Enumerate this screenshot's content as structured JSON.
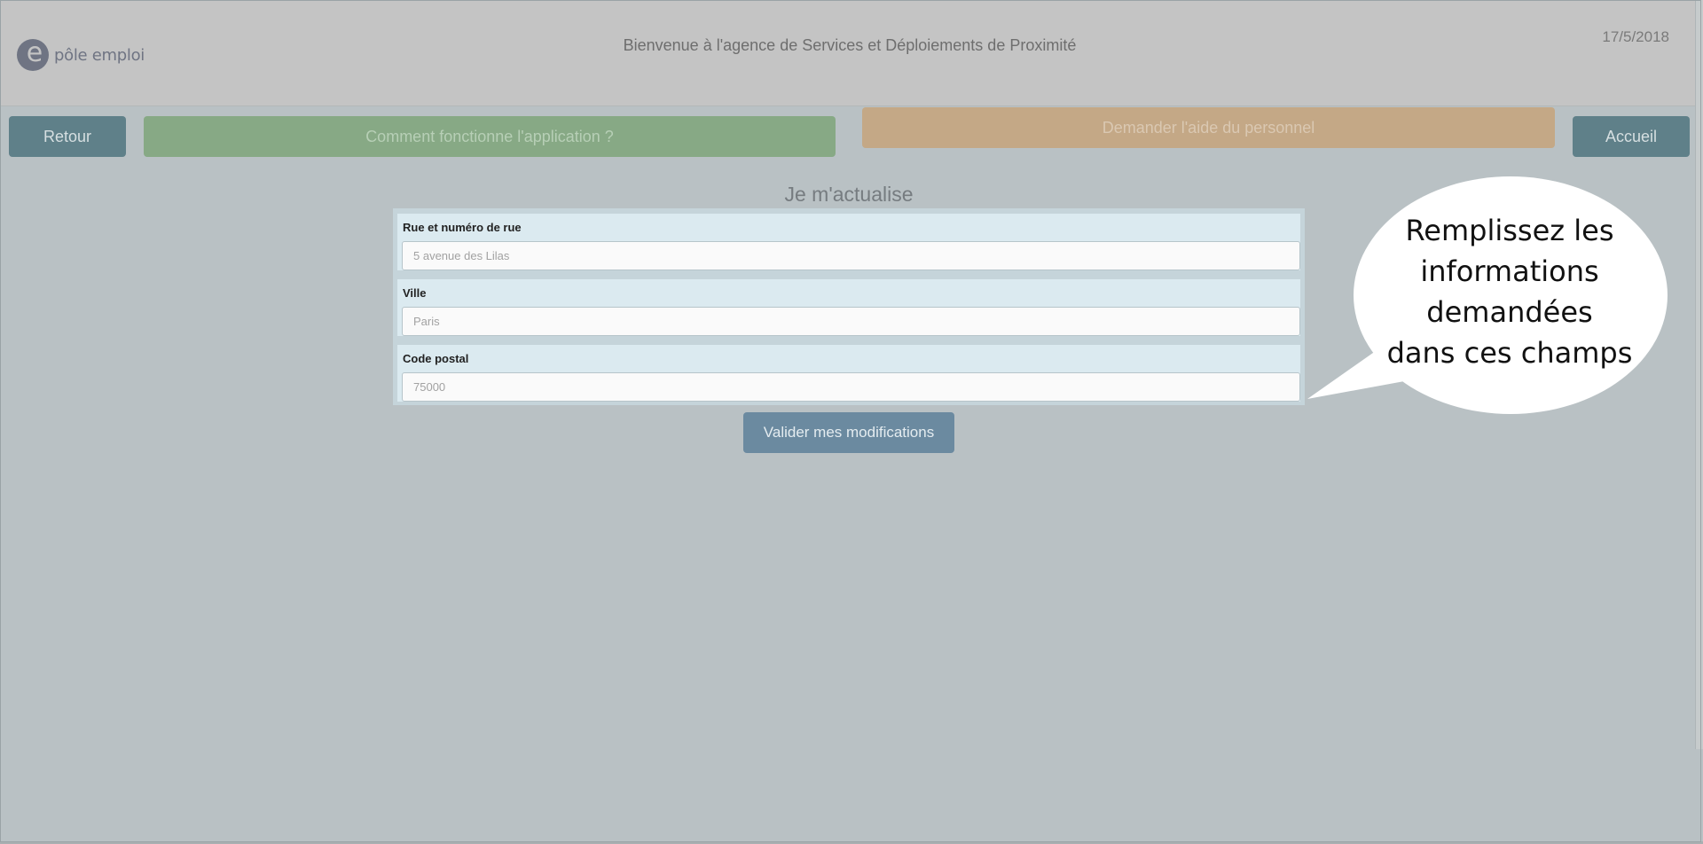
{
  "header": {
    "logo_text": "pôle emploi",
    "welcome": "Bienvenue à l'agence de Services et Déploiements de Proximité",
    "date": "17/5/2018"
  },
  "nav": {
    "retour": "Retour",
    "how_it_works": "Comment fonctionne l'application ?",
    "ask_help": "Demander l'aide du personnel",
    "accueil": "Accueil"
  },
  "form": {
    "title": "Je m'actualise",
    "fields": [
      {
        "label": "Rue et numéro de rue",
        "placeholder": "5 avenue des Lilas"
      },
      {
        "label": "Ville",
        "placeholder": "Paris"
      },
      {
        "label": "Code postal",
        "placeholder": "75000"
      }
    ],
    "submit": "Valider mes modifications"
  },
  "tooltip": {
    "line1": "Remplissez les",
    "line2": "informations",
    "line3": "demandées",
    "line4": "dans ces champs"
  },
  "colors": {
    "overlay_bg": "#b9c1c4",
    "retour_btn": "#5f8089",
    "help_btn": "#c4a886",
    "how_btn": "#87a985",
    "submit_btn": "#6b8aa0"
  }
}
